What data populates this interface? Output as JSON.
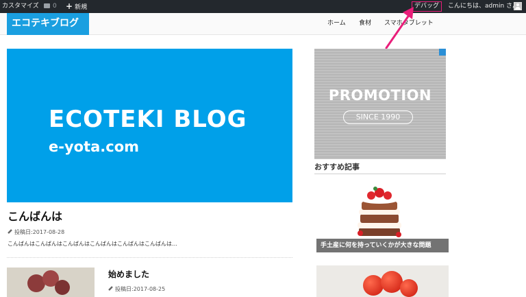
{
  "admin_bar": {
    "customize": "カスタマイズ",
    "comments_count": "0",
    "new": "新規",
    "debug": "デバッグ",
    "greeting": "こんにちは、admin さん"
  },
  "header": {
    "logo": "エコテキブログ",
    "nav": [
      "ホーム",
      "食材",
      "スマホタブレット"
    ]
  },
  "featured_post": {
    "image_line1": "ECOTEKI BLOG",
    "image_line2": "e-yota.com",
    "title": "こんばんは",
    "date": "投稿日:2017-08-28",
    "excerpt": "こんばんはこんばんはこんばんはこんばんはこんばんはこんばんは…"
  },
  "second_post": {
    "title": "始めました",
    "date": "投稿日:2017-08-25"
  },
  "sidebar": {
    "promo_title": "PROMOTION",
    "promo_sub": "SINCE 1990",
    "heading": "おすすめ記事",
    "recommended": [
      {
        "caption": "手土産に何を持っていくかが大きな問題"
      }
    ]
  },
  "colors": {
    "admin_bar": "#23282d",
    "brand_blue": "#1a9fe0",
    "highlight": "#e91e7a"
  }
}
